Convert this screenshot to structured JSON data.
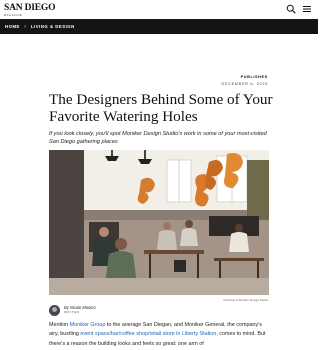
{
  "header": {
    "logo_main": "SAN DIEGO",
    "logo_sub": "MAGAZINE",
    "icons": [
      "search-icon",
      "menu-icon"
    ]
  },
  "breadcrumb": {
    "home": "HOME",
    "separator": ">",
    "section": "LIVING & DESIGN"
  },
  "article": {
    "published_label": "PUBLISHED",
    "date": "DECEMBER 6, 2023",
    "headline": "The Designers Behind Some of Your Favorite Watering Holes",
    "dek": "If you look closely, you'll spot Moniker Design Studio's work in some of your most-visited San Diego gathering places",
    "photo_credit": "Courtesy of Moniker Design Studio",
    "author_by": "By Nicole Monico",
    "author_role": "WRITER",
    "body": {
      "p1_a": "Mention ",
      "p1_link1": "Moniker Group",
      "p1_b": " to the average San Diegan, and Moniker General, the company's airy, bustling ",
      "p1_link2": "event space/bar/coffee shop/retail store in Liberty Station",
      "p1_c": ", comes to mind. But there's a reason the building looks and feels so great: one arm of"
    }
  },
  "colors": {
    "nav_bg": "#141414",
    "link": "#2563b8"
  }
}
